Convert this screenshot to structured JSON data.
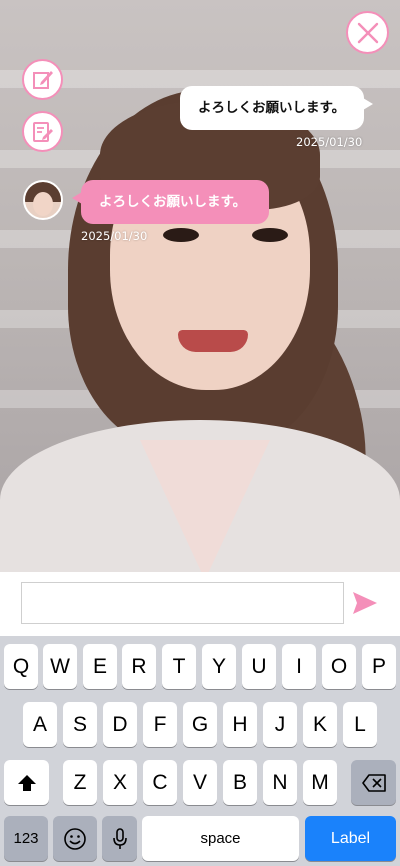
{
  "top_buttons": {
    "close": "close-icon",
    "edit": "edit-icon",
    "note": "note-icon"
  },
  "chat": {
    "messages": [
      {
        "sender": "self",
        "text": "よろしくお願いします。",
        "time": "2025/01/30"
      },
      {
        "sender": "other",
        "text": "よろしくお願いします。",
        "time": "2025/01/30"
      }
    ]
  },
  "input": {
    "value": "",
    "placeholder": ""
  },
  "keyboard": {
    "row1": [
      "Q",
      "W",
      "E",
      "R",
      "T",
      "Y",
      "U",
      "I",
      "O",
      "P"
    ],
    "row2": [
      "A",
      "S",
      "D",
      "F",
      "G",
      "H",
      "J",
      "K",
      "L"
    ],
    "row3": [
      "Z",
      "X",
      "C",
      "V",
      "B",
      "N",
      "M"
    ],
    "bottom": {
      "numbers": "123",
      "space": "space",
      "action": "Label"
    }
  },
  "colors": {
    "accent": "#f48fb9",
    "action_key": "#1a82fb",
    "keyboard_bg": "#d1d3d9"
  }
}
